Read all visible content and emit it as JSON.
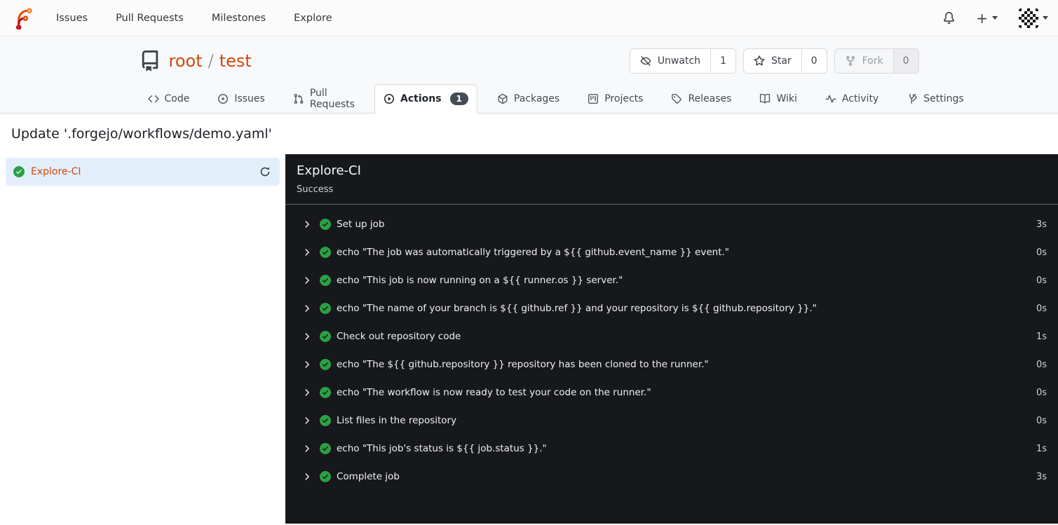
{
  "navbar": {
    "logo": "forgejo-logo",
    "links": [
      {
        "label": "Issues"
      },
      {
        "label": "Pull Requests"
      },
      {
        "label": "Milestones"
      },
      {
        "label": "Explore"
      }
    ],
    "right_icons": [
      {
        "name": "bell-icon"
      },
      {
        "name": "plus-icon"
      },
      {
        "name": "avatar-identicon"
      }
    ]
  },
  "repo": {
    "owner": "root",
    "name": "test",
    "actions": [
      {
        "label": "Unwatch",
        "count": "1",
        "icon": "eye-slash-icon",
        "disabled": false
      },
      {
        "label": "Star",
        "count": "0",
        "icon": "star-icon",
        "disabled": false
      },
      {
        "label": "Fork",
        "count": "0",
        "icon": "fork-icon",
        "disabled": true
      }
    ],
    "tabs": [
      {
        "label": "Code",
        "icon": "code-icon"
      },
      {
        "label": "Issues",
        "icon": "issue-icon"
      },
      {
        "label": "Pull Requests",
        "icon": "pull-request-icon"
      },
      {
        "label": "Actions",
        "icon": "play-circle-icon",
        "badge": "1",
        "active": true
      },
      {
        "label": "Packages",
        "icon": "package-icon"
      },
      {
        "label": "Projects",
        "icon": "project-icon"
      },
      {
        "label": "Releases",
        "icon": "tag-icon"
      },
      {
        "label": "Wiki",
        "icon": "book-icon"
      },
      {
        "label": "Activity",
        "icon": "pulse-icon"
      },
      {
        "label": "Settings",
        "icon": "tools-icon",
        "align": "right"
      }
    ]
  },
  "run": {
    "title": "Update '.forgejo/workflows/demo.yaml'",
    "job": {
      "name": "Explore-CI",
      "status": "Success"
    },
    "steps": [
      {
        "name": "Set up job",
        "duration": "3s"
      },
      {
        "name": "echo \"The job was automatically triggered by a ${{ github.event_name }} event.\"",
        "duration": "0s"
      },
      {
        "name": "echo \"This job is now running on a ${{ runner.os }} server.\"",
        "duration": "0s"
      },
      {
        "name": "echo \"The name of your branch is ${{ github.ref }} and your repository is ${{ github.repository }}.\"",
        "duration": "0s"
      },
      {
        "name": "Check out repository code",
        "duration": "1s"
      },
      {
        "name": "echo \"The ${{ github.repository }} repository has been cloned to the runner.\"",
        "duration": "0s"
      },
      {
        "name": "echo \"The workflow is now ready to test your code on the runner.\"",
        "duration": "0s"
      },
      {
        "name": "List files in the repository",
        "duration": "0s"
      },
      {
        "name": "echo \"This job's status is ${{ job.status }}.\"",
        "duration": "1s"
      },
      {
        "name": "Complete job",
        "duration": "3s"
      }
    ]
  },
  "colors": {
    "accent_orange": "#d0480f",
    "success_green": "#2c9f45",
    "log_panel_bg": "#17181b",
    "selected_job_bg": "#e2effb",
    "tab_badge_bg": "#454c56"
  }
}
